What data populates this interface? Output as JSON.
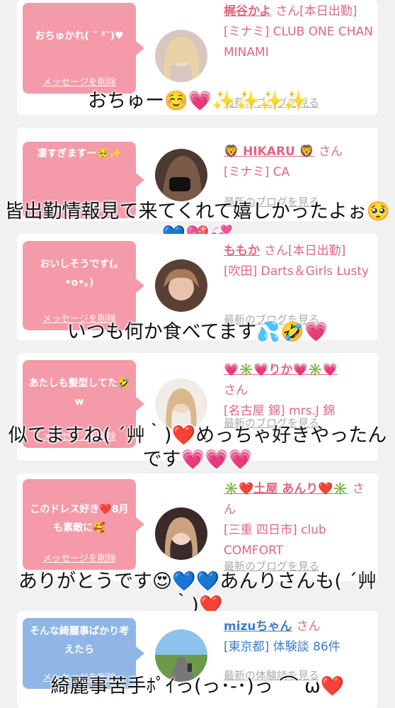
{
  "colors": {
    "page_bg": "#f1f1f1",
    "card_bg": "#ffffff",
    "bubble_pink": "#f49aa8",
    "bubble_blue": "#8fb6e6",
    "name_pink": "#e06682",
    "name_blue": "#3d7cc9",
    "link_gray": "#aaaaaa"
  },
  "delete_label": "メッセージを削除",
  "entries": [
    {
      "bubble_text": "おちゅかれ( ˘ ³˘)♥",
      "bubble_color": "pink",
      "name": "梶谷かよ",
      "san": "さん",
      "status": "[本日出勤]",
      "shop": "[ミナミ] CLUB ONE CHAN MINAMI",
      "blog_link": "最新のブログを見る",
      "avatar_icon": "woman-photo"
    },
    {
      "bubble_text": "凄すぎますー🥺✨",
      "bubble_color": "pink",
      "name": "🦁 HIKARU 🦁",
      "san": "さん",
      "status": "",
      "shop": "[ミナミ] CA",
      "blog_link": "最新のブログを見る",
      "avatar_icon": "woman-photo"
    },
    {
      "bubble_text": "おいしそうです(｡•o•｡)",
      "bubble_color": "pink",
      "name": "ももか",
      "san": "さん",
      "status": "[本日出勤]",
      "shop": "[吹田] Darts＆Girls Lusty",
      "blog_link": "最新のブログを見る",
      "avatar_icon": "woman-photo"
    },
    {
      "bubble_text": "あたしも髪型してた🤣w",
      "bubble_color": "pink",
      "name": "💗✳️💗りか💗✳️💗",
      "san": "さん",
      "status": "",
      "shop": "[名古屋 錦] mrs.J 錦",
      "blog_link": "最新のブログを見る",
      "avatar_icon": "woman-photo"
    },
    {
      "bubble_text": "このドレス好き❤️8月も素敵に🥰",
      "bubble_color": "pink",
      "name": "✳️❤️土屋 あんり❤️✳️",
      "san": "さん",
      "status": "",
      "shop": "[三重 四日市] club COMFORT",
      "blog_link": "最新のブログを見る",
      "avatar_icon": "woman-photo"
    },
    {
      "bubble_text": "そんな綺麗事ばかり考えたら",
      "bubble_color": "blue",
      "name": "mizuちゃん",
      "san": "さん",
      "status": "",
      "shop": "[東京都] 体験談 86件",
      "blog_link": "最新の体験談を見る",
      "avatar_icon": "road-photo"
    }
  ],
  "captions": [
    "おちゅー☺️💗✨✨✨✨",
    "皆出勤情報見て来てくれて嬉しかったよぉ🥺💙💖💞",
    "いつも何か食べてます💦🤣💗",
    "似てますね( ´艸｀)❤️めっちゃ好きやったんです💗💗💗",
    "ありがとうです😍💙💙あんりさんも( ´艸｀)❤️",
    "綺麗事苦手ﾎﾟｲっ(っ･-･)っ ⌒ ω❤️"
  ]
}
